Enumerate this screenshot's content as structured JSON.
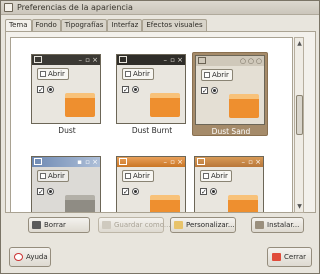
{
  "window": {
    "title": "Preferencias de la apariencia"
  },
  "tabs": [
    {
      "label": "Tema",
      "active": true
    },
    {
      "label": "Fondo",
      "active": false
    },
    {
      "label": "Tipografías",
      "active": false
    },
    {
      "label": "Interfaz",
      "active": false
    },
    {
      "label": "Efectos visuales",
      "active": false
    }
  ],
  "themes": [
    {
      "name": "Dust",
      "open_label": "Abrir",
      "selected": false
    },
    {
      "name": "Dust Burnt",
      "open_label": "Abrir",
      "selected": false
    },
    {
      "name": "Dust Sand",
      "open_label": "Abrir",
      "selected": true
    },
    {
      "name": "",
      "open_label": "Abrir",
      "selected": false
    },
    {
      "name": "",
      "open_label": "Abrir",
      "selected": false
    },
    {
      "name": "",
      "open_label": "Abrir",
      "selected": false
    }
  ],
  "actions": {
    "delete_label": "Borrar",
    "save_as_label": "Guardar como...",
    "customize_label": "Personalizar...",
    "install_label": "Instalar..."
  },
  "footer": {
    "help_label": "Ayuda",
    "close_label": "Cerrar"
  },
  "colors": {
    "selection": "#a58b6a",
    "folder_orange": "#ee8f2f"
  }
}
